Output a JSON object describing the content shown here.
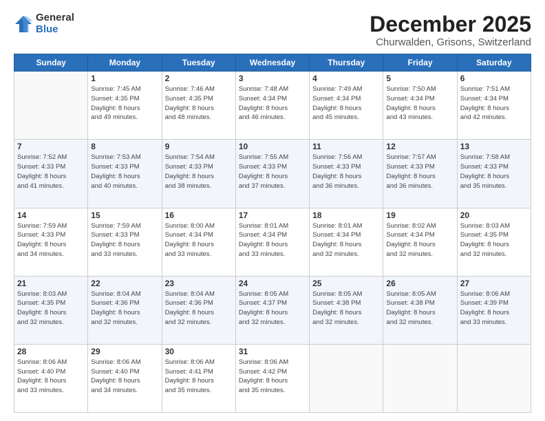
{
  "logo": {
    "general": "General",
    "blue": "Blue"
  },
  "title": "December 2025",
  "subtitle": "Churwalden, Grisons, Switzerland",
  "days_header": [
    "Sunday",
    "Monday",
    "Tuesday",
    "Wednesday",
    "Thursday",
    "Friday",
    "Saturday"
  ],
  "weeks": [
    [
      {
        "day": "",
        "info": ""
      },
      {
        "day": "1",
        "info": "Sunrise: 7:45 AM\nSunset: 4:35 PM\nDaylight: 8 hours\nand 49 minutes."
      },
      {
        "day": "2",
        "info": "Sunrise: 7:46 AM\nSunset: 4:35 PM\nDaylight: 8 hours\nand 48 minutes."
      },
      {
        "day": "3",
        "info": "Sunrise: 7:48 AM\nSunset: 4:34 PM\nDaylight: 8 hours\nand 46 minutes."
      },
      {
        "day": "4",
        "info": "Sunrise: 7:49 AM\nSunset: 4:34 PM\nDaylight: 8 hours\nand 45 minutes."
      },
      {
        "day": "5",
        "info": "Sunrise: 7:50 AM\nSunset: 4:34 PM\nDaylight: 8 hours\nand 43 minutes."
      },
      {
        "day": "6",
        "info": "Sunrise: 7:51 AM\nSunset: 4:34 PM\nDaylight: 8 hours\nand 42 minutes."
      }
    ],
    [
      {
        "day": "7",
        "info": "Sunrise: 7:52 AM\nSunset: 4:33 PM\nDaylight: 8 hours\nand 41 minutes."
      },
      {
        "day": "8",
        "info": "Sunrise: 7:53 AM\nSunset: 4:33 PM\nDaylight: 8 hours\nand 40 minutes."
      },
      {
        "day": "9",
        "info": "Sunrise: 7:54 AM\nSunset: 4:33 PM\nDaylight: 8 hours\nand 38 minutes."
      },
      {
        "day": "10",
        "info": "Sunrise: 7:55 AM\nSunset: 4:33 PM\nDaylight: 8 hours\nand 37 minutes."
      },
      {
        "day": "11",
        "info": "Sunrise: 7:56 AM\nSunset: 4:33 PM\nDaylight: 8 hours\nand 36 minutes."
      },
      {
        "day": "12",
        "info": "Sunrise: 7:57 AM\nSunset: 4:33 PM\nDaylight: 8 hours\nand 36 minutes."
      },
      {
        "day": "13",
        "info": "Sunrise: 7:58 AM\nSunset: 4:33 PM\nDaylight: 8 hours\nand 35 minutes."
      }
    ],
    [
      {
        "day": "14",
        "info": "Sunrise: 7:59 AM\nSunset: 4:33 PM\nDaylight: 8 hours\nand 34 minutes."
      },
      {
        "day": "15",
        "info": "Sunrise: 7:59 AM\nSunset: 4:33 PM\nDaylight: 8 hours\nand 33 minutes."
      },
      {
        "day": "16",
        "info": "Sunrise: 8:00 AM\nSunset: 4:34 PM\nDaylight: 8 hours\nand 33 minutes."
      },
      {
        "day": "17",
        "info": "Sunrise: 8:01 AM\nSunset: 4:34 PM\nDaylight: 8 hours\nand 33 minutes."
      },
      {
        "day": "18",
        "info": "Sunrise: 8:01 AM\nSunset: 4:34 PM\nDaylight: 8 hours\nand 32 minutes."
      },
      {
        "day": "19",
        "info": "Sunrise: 8:02 AM\nSunset: 4:34 PM\nDaylight: 8 hours\nand 32 minutes."
      },
      {
        "day": "20",
        "info": "Sunrise: 8:03 AM\nSunset: 4:35 PM\nDaylight: 8 hours\nand 32 minutes."
      }
    ],
    [
      {
        "day": "21",
        "info": "Sunrise: 8:03 AM\nSunset: 4:35 PM\nDaylight: 8 hours\nand 32 minutes."
      },
      {
        "day": "22",
        "info": "Sunrise: 8:04 AM\nSunset: 4:36 PM\nDaylight: 8 hours\nand 32 minutes."
      },
      {
        "day": "23",
        "info": "Sunrise: 8:04 AM\nSunset: 4:36 PM\nDaylight: 8 hours\nand 32 minutes."
      },
      {
        "day": "24",
        "info": "Sunrise: 8:05 AM\nSunset: 4:37 PM\nDaylight: 8 hours\nand 32 minutes."
      },
      {
        "day": "25",
        "info": "Sunrise: 8:05 AM\nSunset: 4:38 PM\nDaylight: 8 hours\nand 32 minutes."
      },
      {
        "day": "26",
        "info": "Sunrise: 8:05 AM\nSunset: 4:38 PM\nDaylight: 8 hours\nand 32 minutes."
      },
      {
        "day": "27",
        "info": "Sunrise: 8:06 AM\nSunset: 4:39 PM\nDaylight: 8 hours\nand 33 minutes."
      }
    ],
    [
      {
        "day": "28",
        "info": "Sunrise: 8:06 AM\nSunset: 4:40 PM\nDaylight: 8 hours\nand 33 minutes."
      },
      {
        "day": "29",
        "info": "Sunrise: 8:06 AM\nSunset: 4:40 PM\nDaylight: 8 hours\nand 34 minutes."
      },
      {
        "day": "30",
        "info": "Sunrise: 8:06 AM\nSunset: 4:41 PM\nDaylight: 8 hours\nand 35 minutes."
      },
      {
        "day": "31",
        "info": "Sunrise: 8:06 AM\nSunset: 4:42 PM\nDaylight: 8 hours\nand 35 minutes."
      },
      {
        "day": "",
        "info": ""
      },
      {
        "day": "",
        "info": ""
      },
      {
        "day": "",
        "info": ""
      }
    ]
  ]
}
